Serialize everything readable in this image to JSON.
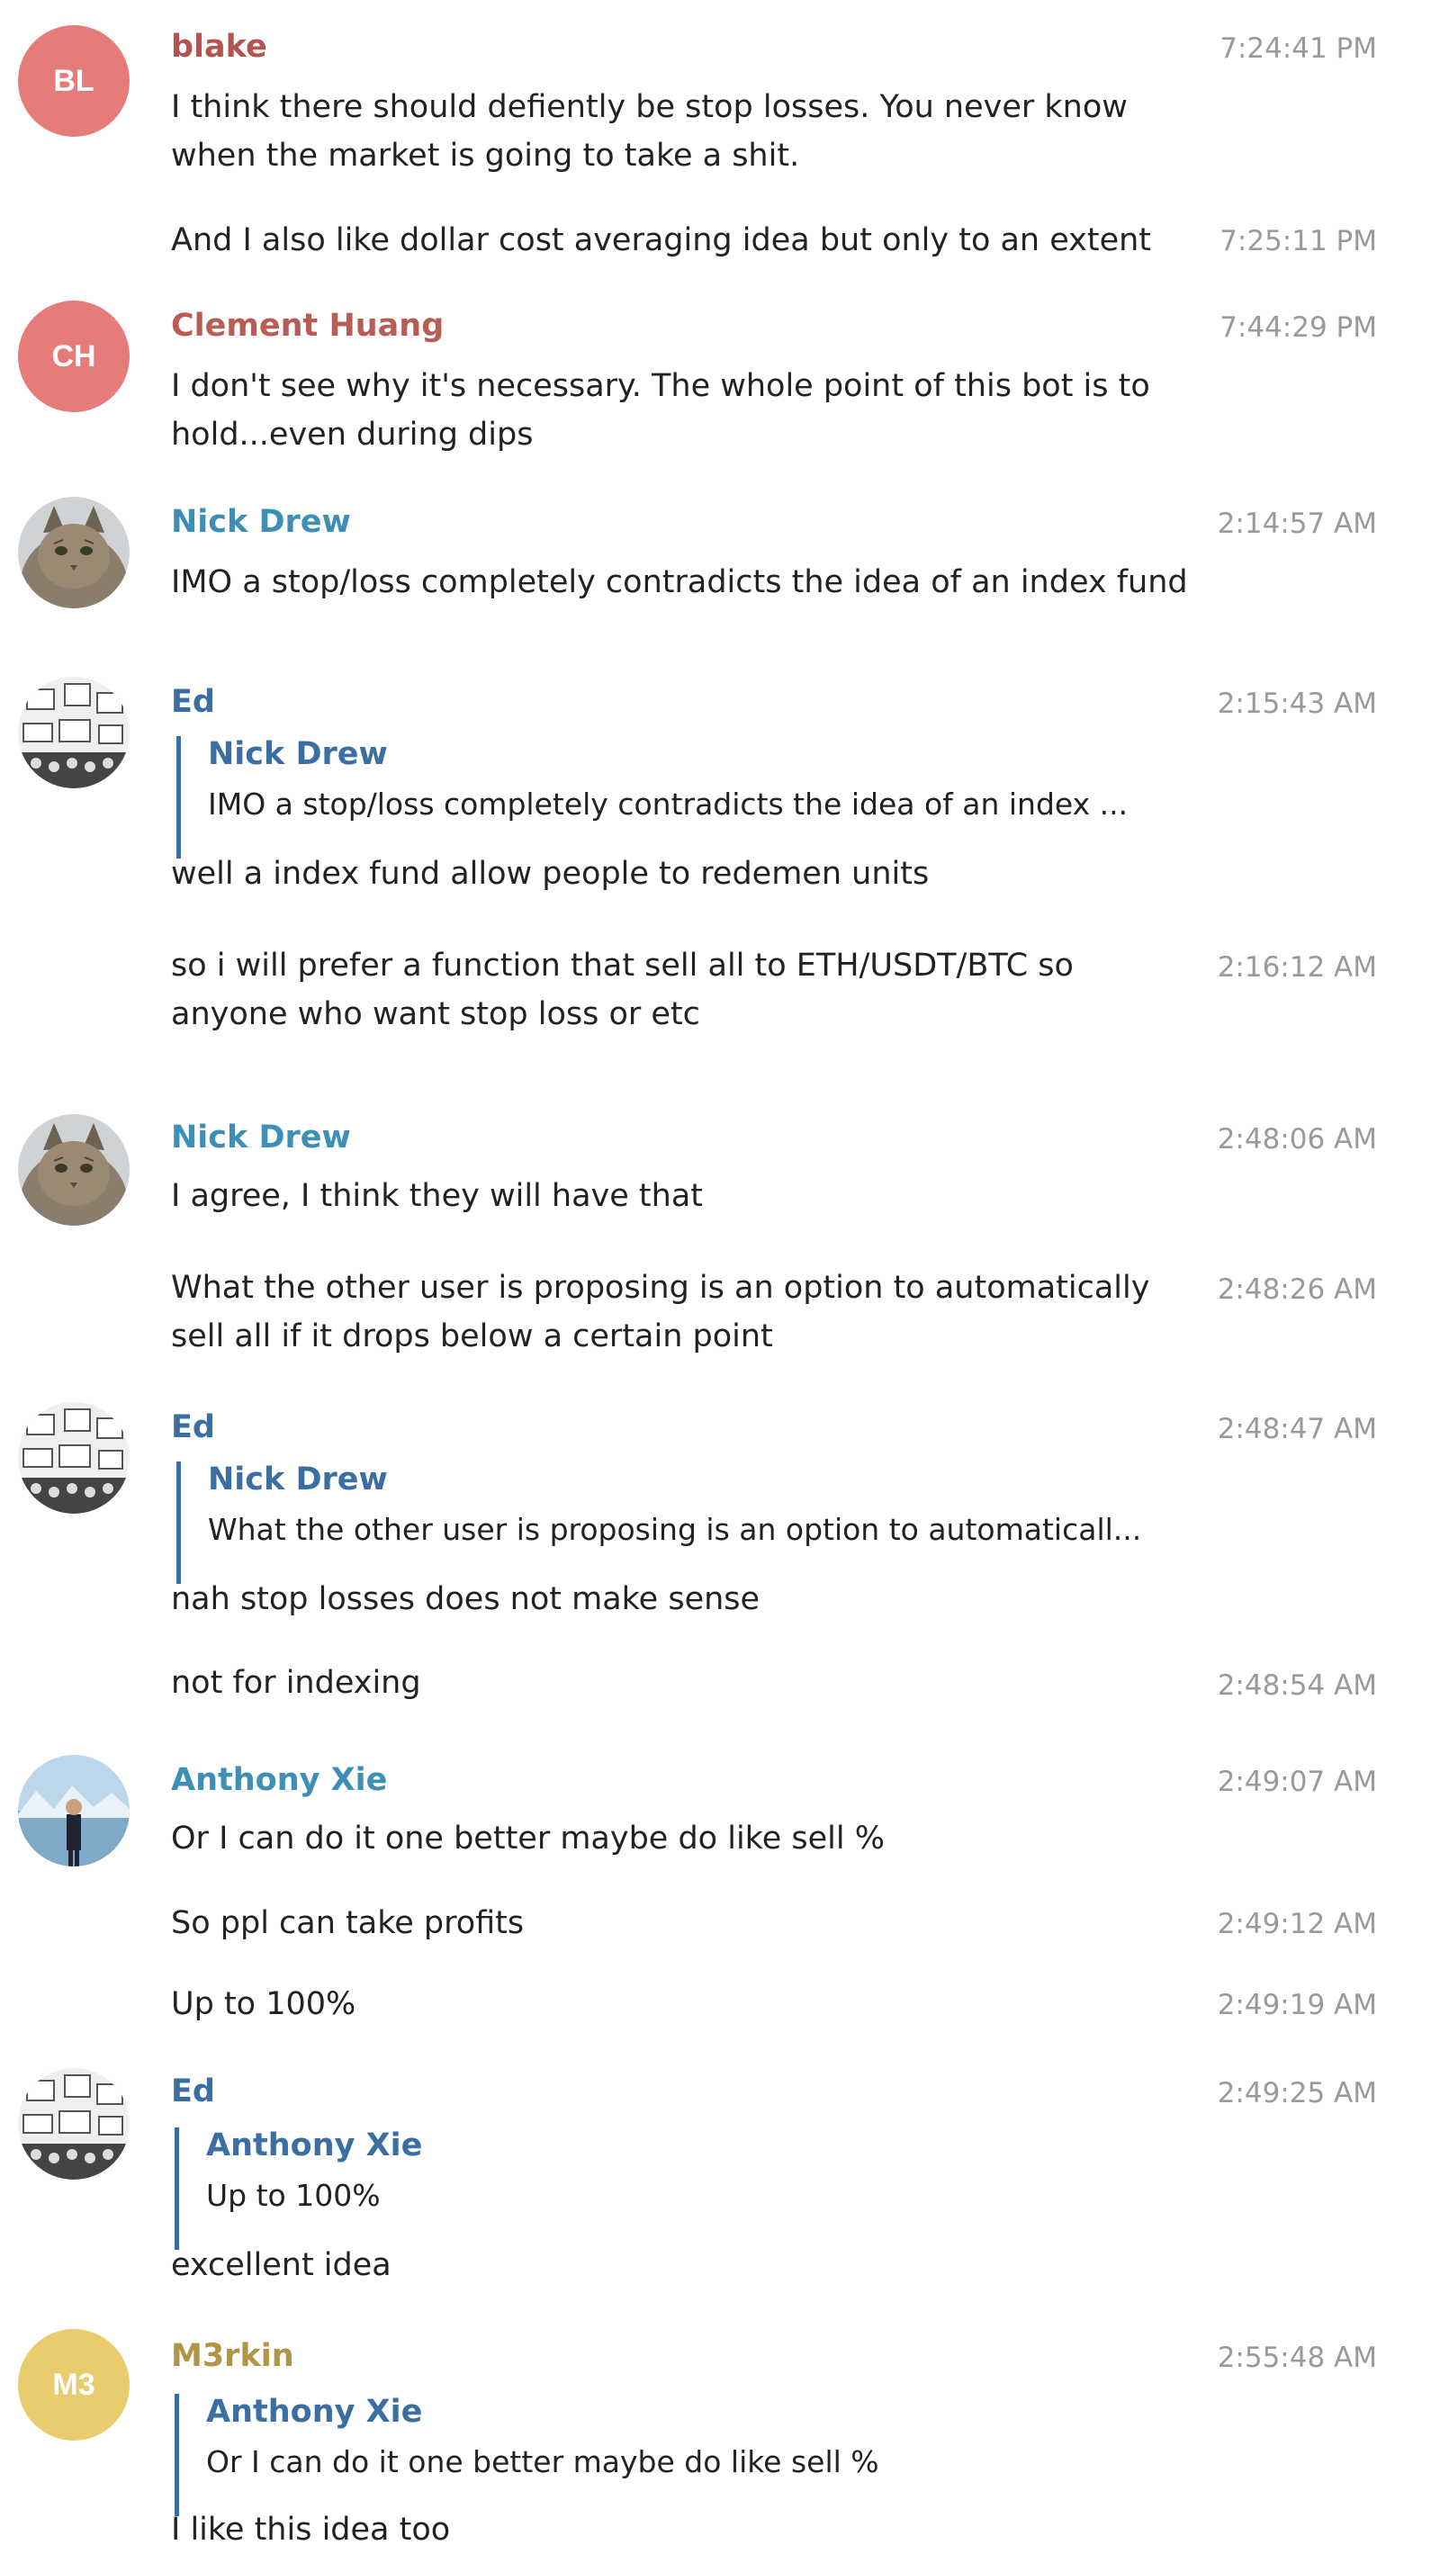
{
  "colors": {
    "blake": "#b35450",
    "clement": "#b85c55",
    "nick": "#3d8fb5",
    "ed": "#3b6ea3",
    "anthony": "#3d8fb5",
    "m3rkin": "#b09545",
    "avatar_bl": "#e57c7a",
    "avatar_ch": "#e57c7a",
    "avatar_m3": "#e8cc6e",
    "reply_bar": "#3b6ea3",
    "timestamp": "#9a9a9a"
  },
  "messages": [
    {
      "sender": "blake",
      "avatar": {
        "type": "initials",
        "initials": "BL"
      },
      "lines": [
        {
          "text": "I think there should defiently be stop losses. You never know",
          "time": "7:24:41 PM"
        },
        {
          "text": "when the market is going to take a shit."
        },
        {
          "text": "And I also like dollar cost averaging idea but only to an extent",
          "time": "7:25:11 PM"
        }
      ]
    },
    {
      "sender": "Clement Huang",
      "avatar": {
        "type": "initials",
        "initials": "CH"
      },
      "lines": [
        {
          "text": "I don't see why it's necessary. The whole point of this bot is to",
          "time": "7:44:29 PM"
        },
        {
          "text": "hold...even during dips"
        }
      ]
    },
    {
      "sender": "Nick Drew",
      "avatar": {
        "type": "photo",
        "icon": "cat-avatar-icon"
      },
      "lines": [
        {
          "text": "IMO a stop/loss completely contradicts the idea of an index fund",
          "time": "2:14:57 AM"
        }
      ]
    },
    {
      "sender": "Ed",
      "avatar": {
        "type": "photo",
        "icon": "sketch-avatar-icon"
      },
      "time": "2:15:43 AM",
      "reply": {
        "name": "Nick Drew",
        "text": "IMO a stop/loss completely contradicts the idea of an index ..."
      },
      "lines": [
        {
          "text": "well a index fund allow people to redemen units"
        },
        {
          "text": "so i will prefer a function that sell all to ETH/USDT/BTC so",
          "time": "2:16:12 AM"
        },
        {
          "text": "anyone who want stop loss or etc"
        }
      ]
    },
    {
      "sender": "Nick Drew",
      "avatar": {
        "type": "photo",
        "icon": "cat-avatar-icon"
      },
      "lines": [
        {
          "text": "I agree, I think they will have that",
          "time": "2:48:06 AM"
        },
        {
          "text": "What the other user is proposing is an option to automatically",
          "time": "2:48:26 AM"
        },
        {
          "text": "sell all if it drops below a certain point"
        }
      ]
    },
    {
      "sender": "Ed",
      "avatar": {
        "type": "photo",
        "icon": "sketch-avatar-icon"
      },
      "time": "2:48:47 AM",
      "reply": {
        "name": "Nick Drew",
        "text": "What the other user is proposing is an option to automaticall..."
      },
      "lines": [
        {
          "text": "nah stop losses does not make sense"
        },
        {
          "text": "not for indexing",
          "time": "2:48:54 AM"
        }
      ]
    },
    {
      "sender": "Anthony Xie",
      "avatar": {
        "type": "photo",
        "icon": "glacier-avatar-icon"
      },
      "lines": [
        {
          "text": "Or I can do it one better maybe do like sell %",
          "time": "2:49:07 AM"
        },
        {
          "text": "So ppl can take profits",
          "time": "2:49:12 AM"
        },
        {
          "text": "Up to 100%",
          "time": "2:49:19 AM"
        }
      ]
    },
    {
      "sender": "Ed",
      "avatar": {
        "type": "photo",
        "icon": "sketch-avatar-icon"
      },
      "time": "2:49:25 AM",
      "reply": {
        "name": "Anthony Xie",
        "text": "Up to 100%"
      },
      "lines": [
        {
          "text": "excellent idea"
        }
      ]
    },
    {
      "sender": "M3rkin",
      "avatar": {
        "type": "initials",
        "initials": "M3"
      },
      "time": "2:55:48 AM",
      "reply": {
        "name": "Anthony Xie",
        "text": "Or I can do it one better maybe do like sell %"
      },
      "lines": [
        {
          "text": "I like this idea too"
        }
      ]
    }
  ]
}
